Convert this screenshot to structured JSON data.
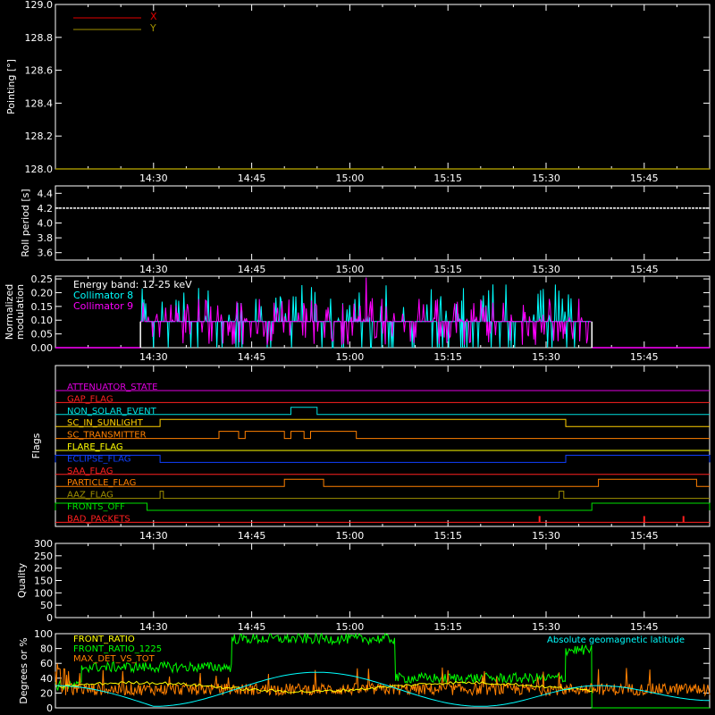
{
  "chart_data": [
    {
      "type": "line",
      "ylabel": "Pointing [°]",
      "ylim": [
        128.0,
        129.0
      ],
      "yticks": [
        "128.0",
        "128.2",
        "128.4",
        "128.6",
        "128.8",
        "129.0"
      ],
      "xlim": [
        "14:15",
        "15:55"
      ],
      "xticks": [
        "14:30",
        "14:45",
        "15:00",
        "15:15",
        "15:30",
        "15:45"
      ],
      "legend": "top-left",
      "series": [
        {
          "name": "X",
          "color": "#e00000",
          "values": []
        },
        {
          "name": "Y",
          "color": "#a09000",
          "values": [
            [
              "14:15",
              128.0
            ],
            [
              "15:55",
              128.0
            ]
          ]
        }
      ]
    },
    {
      "type": "line",
      "ylabel": "Roll period [s]",
      "ylim": [
        3.5,
        4.5
      ],
      "yticks": [
        "3.6",
        "3.8",
        "4.0",
        "4.2",
        "4.4"
      ],
      "xlim": [
        "14:15",
        "15:55"
      ],
      "xticks": [
        "14:30",
        "14:45",
        "15:00",
        "15:15",
        "15:30",
        "15:45"
      ],
      "series": [
        {
          "name": "",
          "color": "#ffffff",
          "values": [
            [
              "14:15",
              4.2
            ],
            [
              "15:55",
              4.2
            ]
          ]
        }
      ]
    },
    {
      "type": "line",
      "ylabel": "Normalized modulation",
      "ylim": [
        0.0,
        0.26
      ],
      "yticks": [
        "0.00",
        "0.05",
        "0.10",
        "0.15",
        "0.20",
        "0.25"
      ],
      "xlim": [
        "14:15",
        "15:55"
      ],
      "xticks": [
        "14:30",
        "14:45",
        "15:00",
        "15:15",
        "15:30",
        "15:45"
      ],
      "annotations": [
        "Energy band: 12-25 keV"
      ],
      "legend": "top-left",
      "active_range": [
        "14:28",
        "15:37"
      ],
      "baseline": 0.095,
      "series": [
        {
          "name": "Collimator 8",
          "color": "#00ffff"
        },
        {
          "name": "Collimator 9",
          "color": "#ff00ff"
        }
      ]
    },
    {
      "type": "step",
      "ylabel": "Flags",
      "xlim": [
        "14:15",
        "15:55"
      ],
      "xticks": [
        "14:30",
        "14:45",
        "15:00",
        "15:15",
        "15:30",
        "15:45"
      ],
      "flags": [
        {
          "name": "ATTENUATOR_STATE",
          "color": "#e000e0",
          "high": []
        },
        {
          "name": "GAP_FLAG",
          "color": "#ff2020",
          "high": []
        },
        {
          "name": "NON_SOLAR_EVENT",
          "color": "#00e0e0",
          "high": [
            [
              "14:51",
              "14:55"
            ]
          ]
        },
        {
          "name": "SC_IN_SUNLIGHT",
          "color": "#ffd000",
          "high": [
            [
              "14:31",
              "15:33"
            ]
          ]
        },
        {
          "name": "SC_TRANSMITTER",
          "color": "#ff8000",
          "high": [
            [
              "14:40",
              "14:43"
            ],
            [
              "14:44",
              "14:50"
            ],
            [
              "14:51",
              "14:53"
            ],
            [
              "14:54",
              "15:01"
            ]
          ]
        },
        {
          "name": "FLARE_FLAG",
          "color": "#ffff00",
          "high": []
        },
        {
          "name": "ECLIPSE_FLAG",
          "color": "#1040ff",
          "high": [
            [
              "14:15",
              "14:31"
            ],
            [
              "15:33",
              "15:55"
            ]
          ]
        },
        {
          "name": "SAA_FLAG",
          "color": "#ff2020",
          "high": []
        },
        {
          "name": "PARTICLE_FLAG",
          "color": "#ff8000",
          "high": [
            [
              "14:50",
              "14:56"
            ],
            [
              "15:38",
              "15:53"
            ]
          ]
        },
        {
          "name": "AAZ_FLAG",
          "color": "#a09000",
          "high": [
            [
              "14:31",
              "14:31.5"
            ],
            [
              "15:32",
              "15:32.7"
            ]
          ]
        },
        {
          "name": "FRONTS_OFF",
          "color": "#00e000",
          "high": [
            [
              "14:15",
              "14:29"
            ],
            [
              "15:37",
              "15:55"
            ]
          ]
        },
        {
          "name": "BAD_PACKETS",
          "color": "#ff2020",
          "high": [],
          "spikes": [
            "15:29",
            "15:45",
            "15:51"
          ]
        }
      ]
    },
    {
      "type": "line",
      "ylabel": "Quality",
      "ylim": [
        0,
        300
      ],
      "yticks": [
        "0",
        "50",
        "100",
        "150",
        "200",
        "250",
        "300"
      ],
      "xlim": [
        "14:15",
        "15:55"
      ],
      "xticks": [
        "14:30",
        "14:45",
        "15:00",
        "15:15",
        "15:30",
        "15:45"
      ],
      "series": []
    },
    {
      "type": "line",
      "ylabel": "Degrees or %",
      "ylim": [
        0,
        100
      ],
      "yticks": [
        "0",
        "20",
        "40",
        "60",
        "80",
        "100"
      ],
      "xlim": [
        "14:15",
        "15:55"
      ],
      "legend": "top-left",
      "series": [
        {
          "name": "FRONT_RATIO",
          "color": "#ffff00"
        },
        {
          "name": "FRONT_RATIO_1225",
          "color": "#00ff00"
        },
        {
          "name": "MAX_DET_VS_TOT",
          "color": "#ff8000"
        },
        {
          "name": "Absolute geomagnetic latitude",
          "color": "#00ffff"
        }
      ],
      "front_ratio_1225_levels": [
        [
          "14:15",
          "14:19",
          30
        ],
        [
          "14:19",
          "14:23",
          55
        ],
        [
          "14:23",
          "14:42",
          55
        ],
        [
          "14:42",
          "15:07",
          93
        ],
        [
          "15:07",
          "15:33",
          40
        ],
        [
          "15:33",
          "15:37",
          78
        ],
        [
          "15:37",
          "15:55",
          0
        ]
      ],
      "geomag_lat_extrema": [
        [
          "14:30",
          2
        ],
        [
          "14:55",
          48
        ],
        [
          "15:20",
          2
        ],
        [
          "15:38",
          30
        ],
        [
          "15:55",
          10
        ]
      ]
    }
  ]
}
